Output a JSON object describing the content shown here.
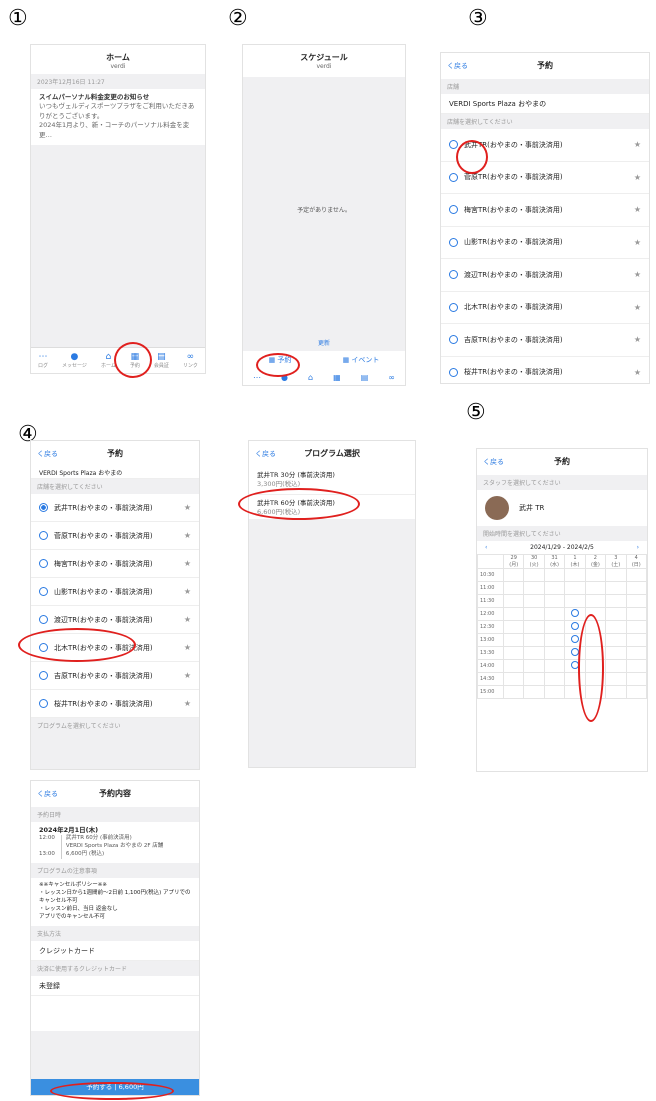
{
  "labels": [
    "①",
    "②",
    "③",
    "④",
    "⑤"
  ],
  "s1": {
    "title": "ホーム",
    "sub": "verdi",
    "date": "2023年12月16日 11:27",
    "news_title": "スイムパーソナル料金変更のお知らせ",
    "news_body": "いつもヴェルディスポーツプラザをご利用いただきありがとうございます。",
    "news_body2": "2024年1月より、新・コーチのパーソナル料金を変更…",
    "tabs": [
      "ログ",
      "メッセージ",
      "ホーム",
      "予約",
      "会員証",
      "リンク"
    ]
  },
  "s2": {
    "title": "スケジュール",
    "sub": "verdi",
    "empty": "予定がありません。",
    "refresh": "更新",
    "reserve": "予約",
    "event": "イベント"
  },
  "s3": {
    "back": "く戻る",
    "title": "予約",
    "store_label": "店舗",
    "store": "VERDI Sports Plaza おやまの",
    "pick_label": "店舗を選択してください",
    "items": [
      "武井TR(おやまの・事前決済用)",
      "菅原TR(おやまの・事前決済用)",
      "梅宮TR(おやまの・事前決済用)",
      "山影TR(おやまの・事前決済用)",
      "渡辺TR(おやまの・事前決済用)",
      "北木TR(おやまの・事前決済用)",
      "吉原TR(おやまの・事前決済用)",
      "桜井TR(おやまの・事前決済用)"
    ]
  },
  "s4": {
    "back": "く戻る",
    "title": "予約",
    "store": "VERDI Sports Plaza おやまの",
    "pick_label": "店舗を選択してください",
    "prog_label": "プログラムを選択してください",
    "items": [
      "武井TR(おやまの・事前決済用)",
      "菅原TR(おやまの・事前決済用)",
      "梅宮TR(おやまの・事前決済用)",
      "山影TR(おやまの・事前決済用)",
      "渡辺TR(おやまの・事前決済用)",
      "北木TR(おやまの・事前決済用)",
      "吉原TR(おやまの・事前決済用)",
      "桜井TR(おやまの・事前決済用)"
    ]
  },
  "s4b": {
    "back": "く戻る",
    "title": "プログラム選択",
    "p1": "武井TR 30分 (事前決済用)",
    "p1price": "3,300円(税込)",
    "p2": "武井TR 60分 (事前決済用)",
    "p2price": "6,600円(税込)"
  },
  "s5": {
    "back": "く戻る",
    "title": "予約",
    "staff_label": "スタッフを選択してください",
    "staff": "武井 TR",
    "date_label": "開始時間を選択してください",
    "range": "2024/1/29 - 2024/2/5",
    "days": [
      "29\n(月)",
      "30\n(火)",
      "31\n(水)",
      "1\n(木)",
      "2\n(金)",
      "3\n(土)",
      "4\n(日)"
    ],
    "times": [
      "10:30",
      "11:00",
      "11:30",
      "12:00",
      "12:30",
      "13:00",
      "13:30",
      "14:00",
      "14:30",
      "15:00"
    ]
  },
  "s6": {
    "back": "く戻る",
    "title": "予約内容",
    "date_label": "予約日時",
    "date": "2024年2月1日(木)",
    "t1": "12:00",
    "t2": "13:00",
    "prog": "武井TR 60分 (事前決済用)",
    "place": "VERDI Sports Plaza おやまの 2F 店舗",
    "price": "6,600円 (税込)",
    "policy_label": "プログラムの注意事項",
    "policy": "※※キャンセルポリシー※※\n・レッスン日から1週間前〜2日前 1,100円(税込) アプリでのキャンセル不可\n・レッスン前日、当日 返金なし\nアプリでのキャンセル不可",
    "pay_label": "支払方法",
    "pay": "クレジットカード",
    "card_label": "決済に使用するクレジットカード",
    "card": "未登録",
    "confirm": "予約する | 6,600円"
  },
  "colors": {
    "accent": "#2a7ae2",
    "ring": "#e0201e"
  }
}
